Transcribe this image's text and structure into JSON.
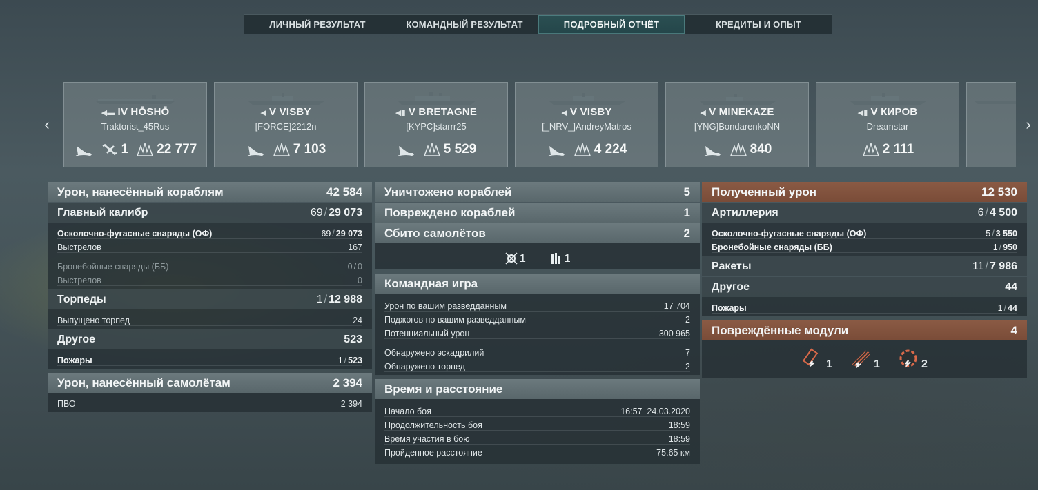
{
  "tabs": [
    "ЛИЧНЫЙ РЕЗУЛЬТАТ",
    "КОМАНДНЫЙ РЕЗУЛЬТАТ",
    "ПОДРОБНЫЙ ОТЧЁТ",
    "КРЕДИТЫ И ОПЫТ"
  ],
  "active_tab": "ПОДРОБНЫЙ ОТЧЁТ",
  "nav": {
    "prev_icon": "chevron-left-icon",
    "next_icon": "chevron-right-icon"
  },
  "ships": [
    {
      "tier": "IV",
      "name": "HŌSHŌ",
      "player": "Traktorist_45Rus",
      "planes": "1",
      "damage": "22 777"
    },
    {
      "tier": "V",
      "name": "VISBY",
      "player": "[FORCE]2212n",
      "damage": "7 103"
    },
    {
      "tier": "V",
      "name": "BRETAGNE",
      "player": "[KYPC]starrr25",
      "damage": "5 529"
    },
    {
      "tier": "V",
      "name": "VISBY",
      "player": "[_NRV_]AndreyMatros",
      "damage": "4 224"
    },
    {
      "tier": "V",
      "name": "MINEKAZE",
      "player": "[YNG]BondarenkoNN",
      "damage": "840"
    },
    {
      "tier": "V",
      "name": "КИРОВ",
      "player": "Dreamstar",
      "damage": "2 111"
    }
  ],
  "left": {
    "header": {
      "label": "Урон, нанесённый кораблям",
      "value": "42 584"
    },
    "main_caliber": {
      "label": "Главный калибр",
      "hits": "69",
      "value": "29 073"
    },
    "he": {
      "label": "Осколочно-фугасные снаряды (ОФ)",
      "hits": "69",
      "value": "29 073"
    },
    "he_shots": {
      "label": "Выстрелов",
      "value": "167"
    },
    "ap": {
      "label": "Бронебойные снаряды (ББ)",
      "hits": "0",
      "value": "0"
    },
    "ap_shots": {
      "label": "Выстрелов",
      "value": "0"
    },
    "torpedoes": {
      "label": "Торпеды",
      "hits": "1",
      "value": "12 988"
    },
    "torp_launched": {
      "label": "Выпущено торпед",
      "value": "24"
    },
    "other": {
      "label": "Другое",
      "value": "523"
    },
    "fires": {
      "label": "Пожары",
      "hits": "1",
      "value": "523"
    },
    "planes_header": {
      "label": "Урон, нанесённый самолётам",
      "value": "2 394"
    },
    "aa": {
      "label": "ПВО",
      "value": "2 394"
    }
  },
  "middle": {
    "destroyed": {
      "label": "Уничтожено кораблей",
      "value": "5"
    },
    "damaged": {
      "label": "Повреждено кораблей",
      "value": "1"
    },
    "planes_shot": {
      "label": "Сбито самолётов",
      "value": "2"
    },
    "plane_icons": [
      {
        "icon": "crosshair-plane-icon",
        "count": "1"
      },
      {
        "icon": "aa-guns-icon",
        "count": "1"
      }
    ],
    "team": {
      "label": "Командная игра",
      "rows": [
        {
          "label": "Урон по вашим разведданным",
          "value": "17 704"
        },
        {
          "label": "Поджогов по вашим разведданным",
          "value": "2"
        },
        {
          "label": "Потенциальный урон",
          "value": "300 965"
        },
        {
          "label": "Обнаружено эскадрилий",
          "value": "7"
        },
        {
          "label": "Обнаружено торпед",
          "value": "2"
        }
      ]
    },
    "time": {
      "label": "Время и расстояние",
      "rows": [
        {
          "label": "Начало боя",
          "value": "16:57  24.03.2020"
        },
        {
          "label": "Продолжительность боя",
          "value": "18:59"
        },
        {
          "label": "Время участия в бою",
          "value": "18:59"
        },
        {
          "label": "Пройденное расстояние",
          "value": "75.65 км"
        }
      ]
    }
  },
  "right": {
    "header": {
      "label": "Полученный урон",
      "value": "12 530"
    },
    "artillery": {
      "label": "Артиллерия",
      "hits": "6",
      "value": "4 500"
    },
    "he": {
      "label": "Осколочно-фугасные снаряды (ОФ)",
      "hits": "5",
      "value": "3 550"
    },
    "ap": {
      "label": "Бронебойные снаряды (ББ)",
      "hits": "1",
      "value": "950"
    },
    "rockets": {
      "label": "Ракеты",
      "hits": "11",
      "value": "7 986"
    },
    "other": {
      "label": "Другое",
      "value": "44"
    },
    "fires": {
      "label": "Пожары",
      "hits": "1",
      "value": "44"
    },
    "modules": {
      "label": "Повреждённые модули",
      "value": "4"
    },
    "module_icons": [
      {
        "icon": "damaged-torpedo-tube-icon",
        "count": "1"
      },
      {
        "icon": "damaged-gun-icon",
        "count": "1"
      },
      {
        "icon": "damaged-engine-icon",
        "count": "2"
      }
    ]
  }
}
